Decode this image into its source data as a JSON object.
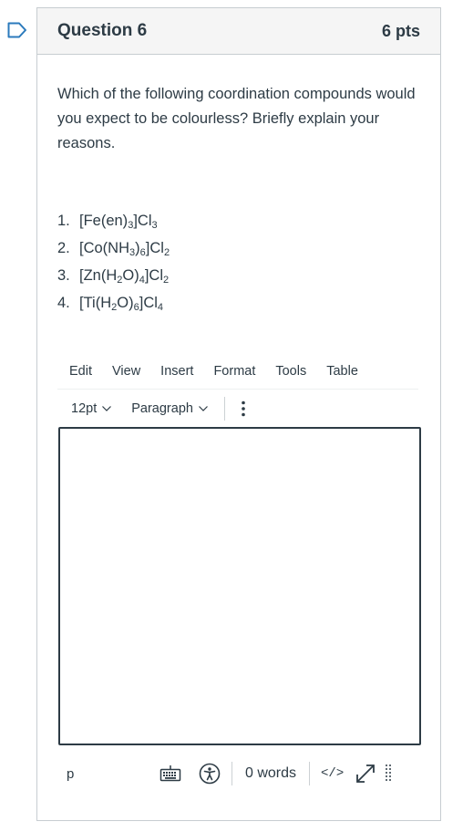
{
  "question": {
    "title": "Question 6",
    "points": "6 pts",
    "text": "Which of the following coordination compounds would you expect to be colourless? Briefly explain your reasons.",
    "options": [
      {
        "number": "1.",
        "parts": [
          "[Fe(en)",
          {
            "sub": "3"
          },
          "]Cl",
          {
            "sub": "3"
          }
        ]
      },
      {
        "number": "2.",
        "parts": [
          "[Co(NH",
          {
            "sub": "3"
          },
          ")",
          {
            "sub": "6"
          },
          "]Cl",
          {
            "sub": "2"
          }
        ]
      },
      {
        "number": "3.",
        "parts": [
          "[Zn(H",
          {
            "sub": "2"
          },
          "O)",
          {
            "sub": "4"
          },
          "]Cl",
          {
            "sub": "2"
          }
        ]
      },
      {
        "number": "4.",
        "parts": [
          "[Ti(H",
          {
            "sub": "2"
          },
          "O)",
          {
            "sub": "6"
          },
          "]Cl",
          {
            "sub": "4"
          }
        ]
      }
    ]
  },
  "editor": {
    "menu": [
      "Edit",
      "View",
      "Insert",
      "Format",
      "Tools",
      "Table"
    ],
    "font_size": "12pt",
    "block_format": "Paragraph",
    "content": "",
    "status": {
      "path": "p",
      "word_count": "0 words",
      "code_toggle": "</>"
    },
    "icons": {
      "flag": "flag-outline-icon",
      "chevron": "chevron-down-icon",
      "more": "vertical-dots-icon",
      "keyboard": "keyboard-icon",
      "accessibility": "accessibility-icon",
      "expand": "expand-arrows-icon",
      "grip": "resize-grip-icon"
    }
  }
}
